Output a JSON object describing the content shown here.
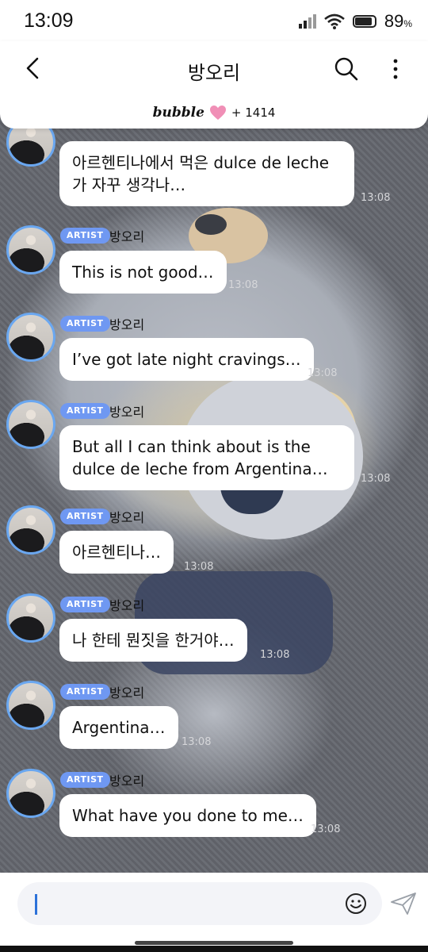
{
  "status": {
    "time": "13:09",
    "battery": "89",
    "battery_unit": "%"
  },
  "header": {
    "title": "방오리",
    "bubble_logo": "bubble",
    "subscriber_count": "+ 1414"
  },
  "messages": [
    {
      "badge": "ARTIST",
      "sender": "방오리",
      "text": "아르헨티나에서 먹은 dulce de leche\n가 자꾸 생각나…",
      "time": "13:08"
    },
    {
      "badge": "ARTIST",
      "sender": "방오리",
      "text": "This is not good…",
      "time": "13:08"
    },
    {
      "badge": "ARTIST",
      "sender": "방오리",
      "text": "I’ve got late night cravings…",
      "time": "13:08"
    },
    {
      "badge": "ARTIST",
      "sender": "방오리",
      "text": "But all I can think about is the\ndulce de leche from Argentina…",
      "time": "13:08"
    },
    {
      "badge": "ARTIST",
      "sender": "방오리",
      "text": "아르헨티나…",
      "time": "13:08"
    },
    {
      "badge": "ARTIST",
      "sender": "방오리",
      "text": "나 한테 뭔짓을 한거야…",
      "time": "13:08"
    },
    {
      "badge": "ARTIST",
      "sender": "방오리",
      "text": "Argentina…",
      "time": "13:08"
    },
    {
      "badge": "ARTIST",
      "sender": "방오리",
      "text": "What have you done to me…",
      "time": "13:08"
    }
  ],
  "input": {
    "value": ""
  },
  "colors": {
    "accent": "#6f98f2",
    "avatar_ring": "#6aa7f0",
    "caret": "#2d72d9",
    "heart": "#f08fb6"
  },
  "icons": [
    "back-icon",
    "search-icon",
    "more-icon",
    "heart-icon",
    "emoji-icon",
    "send-icon",
    "wifi-icon",
    "signal-icon",
    "battery-icon"
  ]
}
